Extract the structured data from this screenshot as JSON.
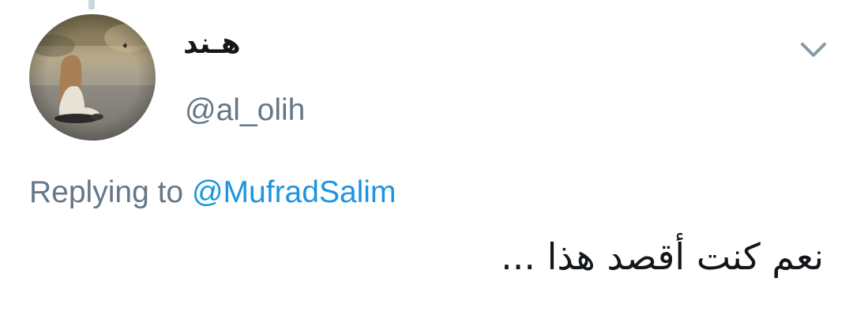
{
  "tweet": {
    "author": {
      "display_name": "هـند",
      "handle": "@al_olih",
      "avatar_icon": "profile-photo-girl-sitting-icon"
    },
    "menu_icon": "chevron-down-icon",
    "reply": {
      "prefix": "Replying to",
      "mention": "@MufradSalim"
    },
    "text": "نعم كنت أقصد هذا ..."
  },
  "colors": {
    "text_primary": "#14171a",
    "text_secondary": "#657786",
    "link": "#1b95e0",
    "thread_line": "#ccd6dd"
  }
}
